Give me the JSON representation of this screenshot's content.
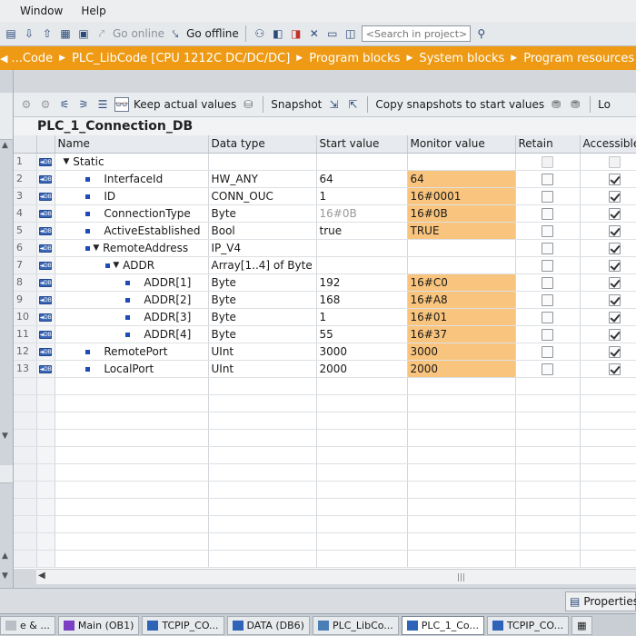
{
  "menu": {
    "items": [
      "Window",
      "Help"
    ]
  },
  "toolbar": {
    "go_online": "Go online",
    "go_offline": "Go offline",
    "search_placeholder": "<Search in project>"
  },
  "breadcrumb": {
    "items": [
      "...Code",
      "PLC_LibCode [CPU 1212C DC/DC/DC]",
      "Program blocks",
      "System blocks",
      "Program resources"
    ]
  },
  "editor_toolbar": {
    "keep_actual_values": "Keep actual values",
    "snapshot": "Snapshot",
    "copy_snapshots": "Copy snapshots to start values",
    "extra": "Lo"
  },
  "db": {
    "name": "PLC_1_Connection_DB"
  },
  "table": {
    "columns": [
      "Name",
      "Data type",
      "Start value",
      "Monitor value",
      "Retain",
      "Accessible f"
    ],
    "rows": [
      {
        "num": "1",
        "level": 0,
        "expand": "open",
        "bullet": false,
        "name": "Static",
        "type": "",
        "start": "",
        "monitor": "",
        "retain": null,
        "access": null
      },
      {
        "num": "2",
        "level": 1,
        "expand": "",
        "bullet": true,
        "name": "InterfaceId",
        "type": "HW_ANY",
        "start": "64",
        "monitor": "64",
        "retain": false,
        "access": true
      },
      {
        "num": "3",
        "level": 1,
        "expand": "",
        "bullet": true,
        "name": "ID",
        "type": "CONN_OUC",
        "start": "1",
        "monitor": "16#0001",
        "retain": false,
        "access": true
      },
      {
        "num": "4",
        "level": 1,
        "expand": "",
        "bullet": true,
        "name": "ConnectionType",
        "type": "Byte",
        "start": "16#0B",
        "monitor": "16#0B",
        "retain": false,
        "access": true,
        "start_dim": true
      },
      {
        "num": "5",
        "level": 1,
        "expand": "",
        "bullet": true,
        "name": "ActiveEstablished",
        "type": "Bool",
        "start": "true",
        "monitor": "TRUE",
        "retain": false,
        "access": true
      },
      {
        "num": "6",
        "level": 1,
        "expand": "open",
        "bullet": true,
        "name": "RemoteAddress",
        "type": "IP_V4",
        "start": "",
        "monitor": "",
        "retain": false,
        "access": true
      },
      {
        "num": "7",
        "level": 2,
        "expand": "open",
        "bullet": true,
        "name": "ADDR",
        "type": "Array[1..4] of Byte",
        "start": "",
        "monitor": "",
        "retain": false,
        "access": true
      },
      {
        "num": "8",
        "level": 3,
        "expand": "",
        "bullet": true,
        "name": "ADDR[1]",
        "type": "Byte",
        "start": "192",
        "monitor": "16#C0",
        "retain": false,
        "access": true
      },
      {
        "num": "9",
        "level": 3,
        "expand": "",
        "bullet": true,
        "name": "ADDR[2]",
        "type": "Byte",
        "start": "168",
        "monitor": "16#A8",
        "retain": false,
        "access": true
      },
      {
        "num": "10",
        "level": 3,
        "expand": "",
        "bullet": true,
        "name": "ADDR[3]",
        "type": "Byte",
        "start": "1",
        "monitor": "16#01",
        "retain": false,
        "access": true
      },
      {
        "num": "11",
        "level": 3,
        "expand": "",
        "bullet": true,
        "name": "ADDR[4]",
        "type": "Byte",
        "start": "55",
        "monitor": "16#37",
        "retain": false,
        "access": true
      },
      {
        "num": "12",
        "level": 1,
        "expand": "",
        "bullet": true,
        "name": "RemotePort",
        "type": "UInt",
        "start": "3000",
        "monitor": "3000",
        "retain": false,
        "access": true
      },
      {
        "num": "13",
        "level": 1,
        "expand": "",
        "bullet": true,
        "name": "LocalPort",
        "type": "UInt",
        "start": "2000",
        "monitor": "2000",
        "retain": false,
        "access": true
      }
    ]
  },
  "properties_tab": {
    "label": "Properties"
  },
  "taskbar": {
    "items": [
      {
        "label": "e & ...",
        "icon_color": "#b9bfc6",
        "active": false
      },
      {
        "label": "Main (OB1)",
        "icon_color": "#7a3fc2",
        "active": false
      },
      {
        "label": "TCPIP_CO...",
        "icon_color": "#2f63b8",
        "active": false
      },
      {
        "label": "DATA (DB6)",
        "icon_color": "#2f63b8",
        "active": false
      },
      {
        "label": "PLC_LibCo...",
        "icon_color": "#4a7fb5",
        "active": false
      },
      {
        "label": "PLC_1_Co...",
        "icon_color": "#2f63b8",
        "active": true
      },
      {
        "label": "TCPIP_CO...",
        "icon_color": "#2f63b8",
        "active": false
      }
    ]
  },
  "colors": {
    "accent": "#ee9a14",
    "monitor_bg": "#f9c57e"
  }
}
